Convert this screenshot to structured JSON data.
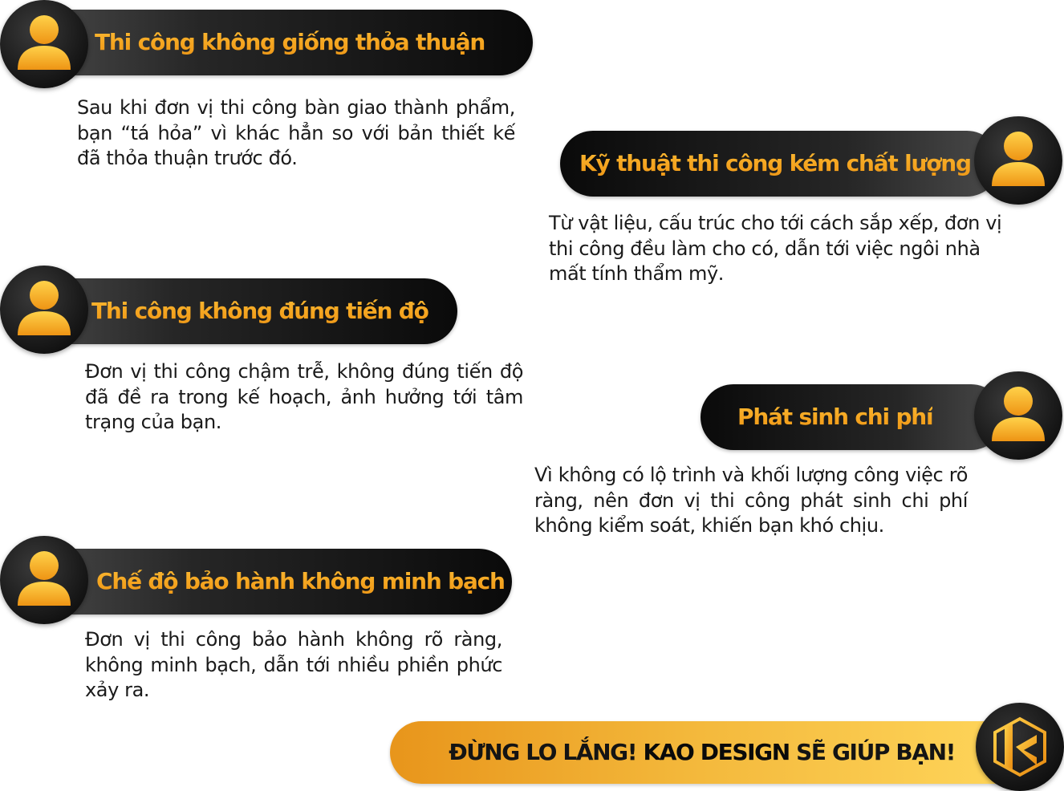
{
  "cards": [
    {
      "title": "Thi công không giống thỏa thuận",
      "icon": "user-icon",
      "description": "Sau khi đơn vị thi công bàn giao thành phẩm, bạn “tá hỏa” vì khác hẳn so với bản thiết kế đã thỏa thuận trước đó."
    },
    {
      "title": "Kỹ thuật thi công kém chất lượng",
      "icon": "user-icon",
      "description": "Từ vật liệu, cấu trúc cho tới cách sắp xếp, đơn vị thi công đều làm cho có, dẫn tới việc ngôi nhà mất tính thẩm mỹ."
    },
    {
      "title": "Thi công không đúng tiến độ",
      "icon": "user-icon",
      "description": "Đơn vị thi công chậm trễ, không đúng tiến độ đã đề ra trong kế hoạch, ảnh hưởng tới tâm trạng của bạn."
    },
    {
      "title": "Phát sinh chi phí",
      "icon": "user-icon",
      "description": "Vì không có lộ trình và khối lượng công việc rõ ràng, nên đơn vị thi công phát sinh chi phí không kiểm soát, khiến bạn khó chịu."
    },
    {
      "title": "Chế độ bảo hành không minh bạch",
      "icon": "user-icon",
      "description": "Đơn vị thi công bảo hành không rõ ràng, không minh bạch, dẫn tới nhiều phiền phức xảy ra."
    }
  ],
  "cta": {
    "prefix": "ĐỪNG LO LẮNG! ",
    "brand": "KAO DESIGN",
    "suffix": " SẼ GIÚP BẠN!",
    "logo_icon": "kao-design-logo-icon"
  },
  "colors": {
    "gold": "#f4a21e",
    "gold_light": "#ffd24a",
    "pill_dark": "#0a0a0a",
    "text": "#1a1a1a"
  }
}
